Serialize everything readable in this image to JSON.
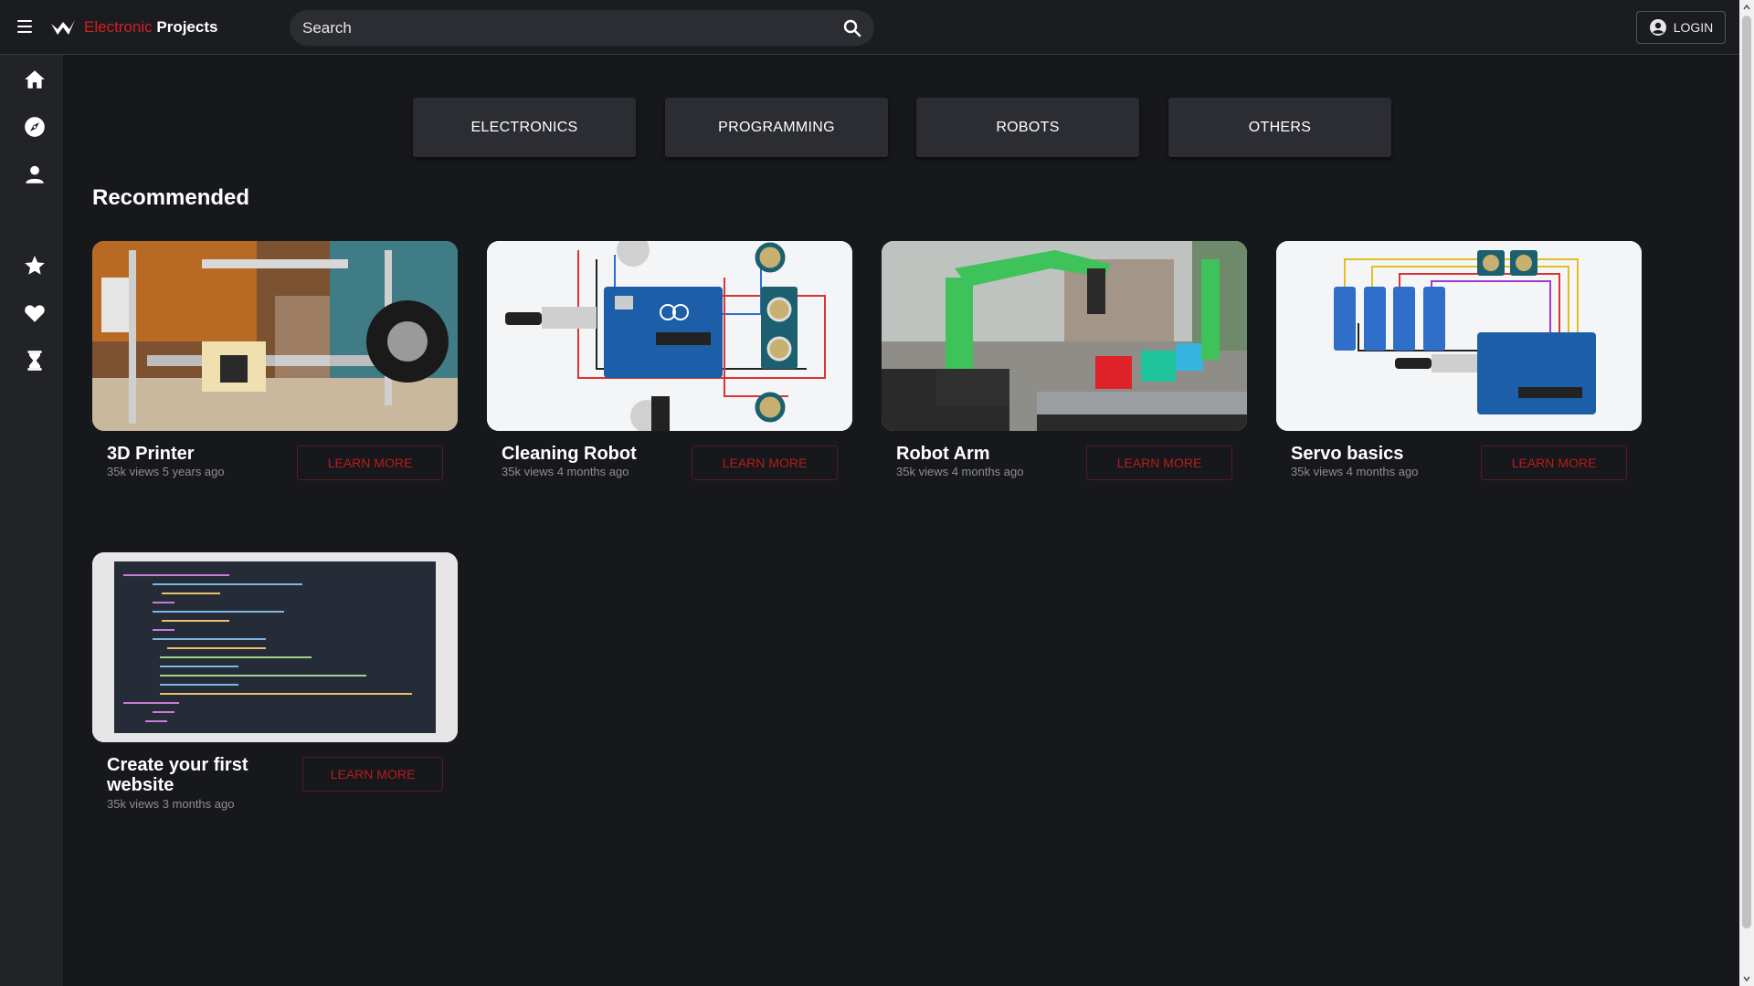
{
  "header": {
    "brand_part1": "Electronic",
    "brand_part2": "Projects",
    "search_placeholder": "Search",
    "login_label": "LOGIN"
  },
  "sidebar": {
    "icons": [
      "home-icon",
      "compass-icon",
      "person-icon",
      "star-icon",
      "heart-icon",
      "hourglass-icon"
    ]
  },
  "categories": [
    "ELECTRONICS",
    "PROGRAMMING",
    "ROBOTS",
    "OTHERS"
  ],
  "section_title": "Recommended",
  "cards": [
    {
      "title": "3D Printer",
      "meta": "35k views 5 years ago",
      "button": "LEARN MORE"
    },
    {
      "title": "Cleaning Robot",
      "meta": "35k views 4 months ago",
      "button": "LEARN MORE"
    },
    {
      "title": "Robot Arm",
      "meta": "35k views 4 months ago",
      "button": "LEARN MORE"
    },
    {
      "title": "Servo basics",
      "meta": "35k views 4 months ago",
      "button": "LEARN MORE"
    },
    {
      "title": "Create your first website",
      "meta": "35k views 3 months ago",
      "button": "LEARN MORE"
    }
  ],
  "colors": {
    "brand_accent": "#d41f1f",
    "button_text": "#b71c1c",
    "background": "#17181c"
  }
}
